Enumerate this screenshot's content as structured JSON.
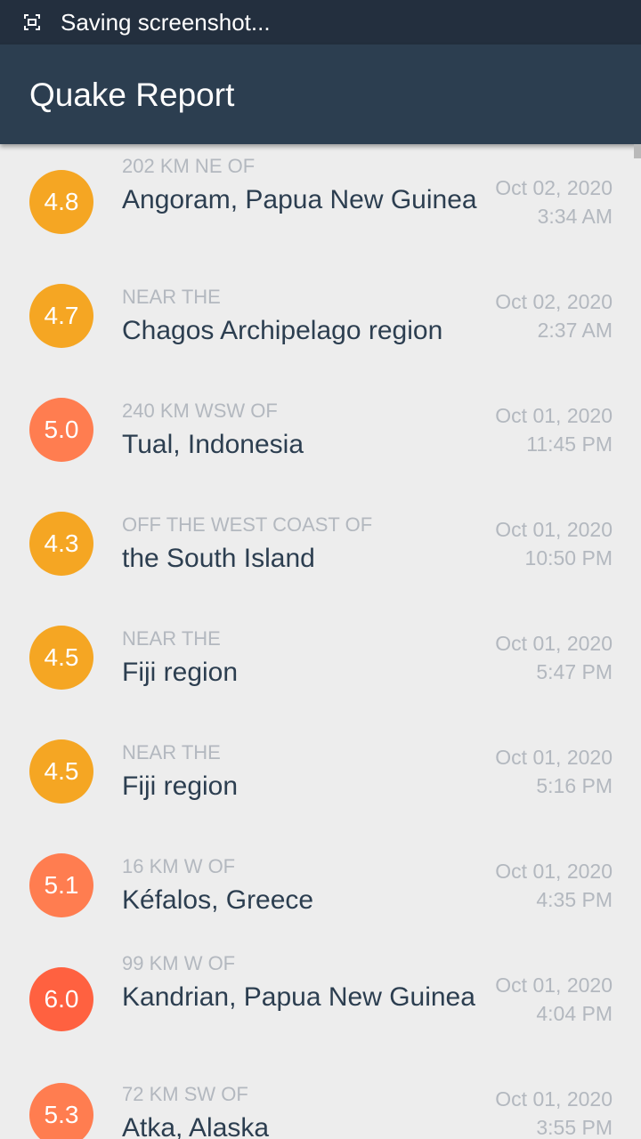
{
  "status_bar": {
    "icon": "screenshot-icon",
    "text": "Saving screenshot..."
  },
  "app_bar": {
    "title": "Quake Report",
    "background": "#2c3e50"
  },
  "colors": {
    "mag_4_5": "#f5a623",
    "mag_5_6": "#ff7d50",
    "mag_6_7": "#ff6140",
    "secondary_text": "#b3b8bf",
    "primary_text": "#2c3e50"
  },
  "earthquakes": [
    {
      "magnitude": "4.8",
      "color": "#f5a623",
      "offset": "202 KM NE OF",
      "location": "Angoram, Papua New Guinea",
      "date": "Oct 02, 2020",
      "time": "3:34 AM"
    },
    {
      "magnitude": "4.7",
      "color": "#f5a623",
      "offset": "NEAR THE",
      "location": "Chagos Archipelago region",
      "date": "Oct 02, 2020",
      "time": "2:37 AM"
    },
    {
      "magnitude": "5.0",
      "color": "#ff7d50",
      "offset": "240 KM WSW OF",
      "location": "Tual, Indonesia",
      "date": "Oct 01, 2020",
      "time": "11:45 PM"
    },
    {
      "magnitude": "4.3",
      "color": "#f5a623",
      "offset": "OFF THE WEST COAST OF",
      "location": "the South Island",
      "date": "Oct 01, 2020",
      "time": "10:50 PM"
    },
    {
      "magnitude": "4.5",
      "color": "#f5a623",
      "offset": "NEAR THE",
      "location": "Fiji region",
      "date": "Oct 01, 2020",
      "time": "5:47 PM"
    },
    {
      "magnitude": "4.5",
      "color": "#f5a623",
      "offset": "NEAR THE",
      "location": "Fiji region",
      "date": "Oct 01, 2020",
      "time": "5:16 PM"
    },
    {
      "magnitude": "5.1",
      "color": "#ff7d50",
      "offset": "16 KM W OF",
      "location": "Kéfalos, Greece",
      "date": "Oct 01, 2020",
      "time": "4:35 PM"
    },
    {
      "magnitude": "6.0",
      "color": "#ff6140",
      "offset": "99 KM W OF",
      "location": "Kandrian, Papua New Guinea",
      "date": "Oct 01, 2020",
      "time": "4:04 PM"
    },
    {
      "magnitude": "5.3",
      "color": "#ff7d50",
      "offset": "72 KM SW OF",
      "location": "Atka, Alaska",
      "date": "Oct 01, 2020",
      "time": "3:55 PM"
    }
  ]
}
